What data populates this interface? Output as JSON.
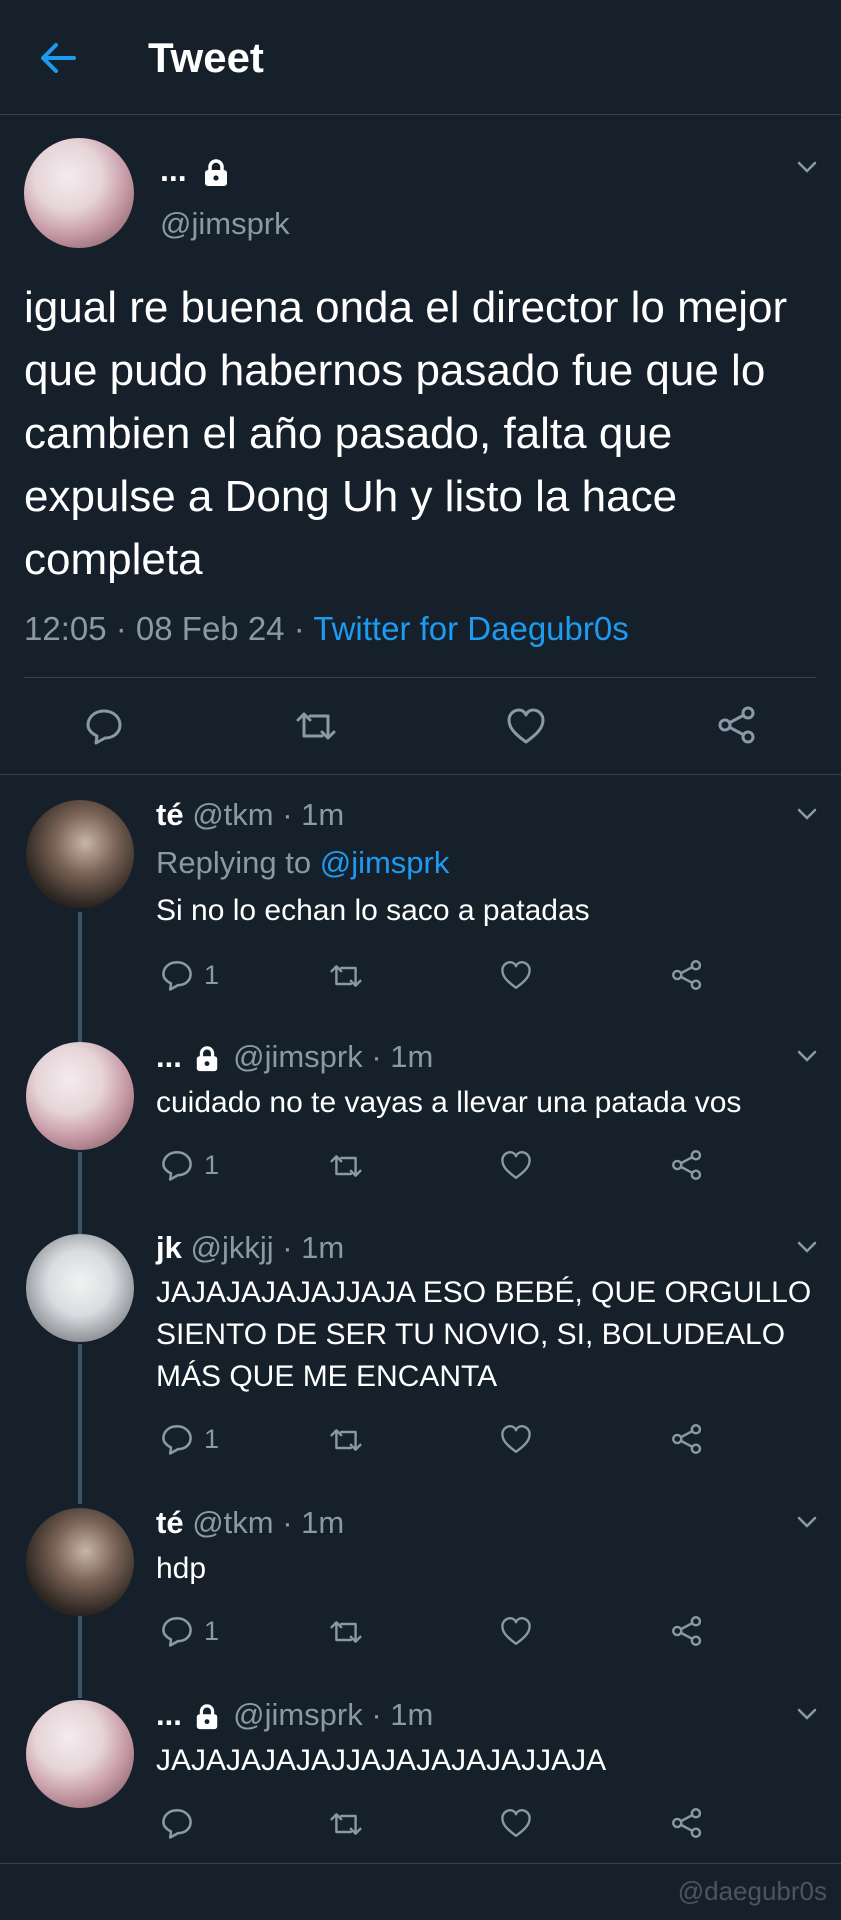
{
  "header": {
    "title": "Tweet"
  },
  "main_tweet": {
    "name": "...",
    "handle": "@jimsprk",
    "text": "igual re buena onda el director lo mejor que pudo habernos pasado fue que lo cambien el año pasado, falta que expulse a Dong Uh y listo la hace completa",
    "time": "12:05 · 08 Feb 24 · ",
    "source": "Twitter for Daegubr0s"
  },
  "replies": [
    {
      "name": "té",
      "handle": "@tkm · 1m",
      "replying_prefix": "Replying to ",
      "replying_to": "@jimsprk",
      "text": "Si no lo echan lo saco a patadas",
      "reply_count": "1"
    },
    {
      "name": "...",
      "handle": "@jimsprk · 1m",
      "text": "cuidado no te vayas a llevar una patada vos",
      "reply_count": "1"
    },
    {
      "name": "jk",
      "handle": "@jkkjj · 1m",
      "text": "JAJAJAJAJAJJAJA ESO BEBÉ, QUE ORGULLO SIENTO DE SER TU NOVIO, SI, BOLUDEALO MÁS QUE ME ENCANTA",
      "reply_count": "1"
    },
    {
      "name": "té",
      "handle": "@tkm · 1m",
      "text": "hdp",
      "reply_count": "1"
    },
    {
      "name": "...",
      "handle": "@jimsprk · 1m",
      "text": "JAJAJAJAJAJJAJAJAJAJAJJAJA",
      "reply_count": ""
    }
  ],
  "watermark": "@daegubr0s",
  "colors": {
    "background": "#15202b",
    "accent": "#1d9bf0",
    "muted": "#8b98a5",
    "divider": "#38444d"
  }
}
